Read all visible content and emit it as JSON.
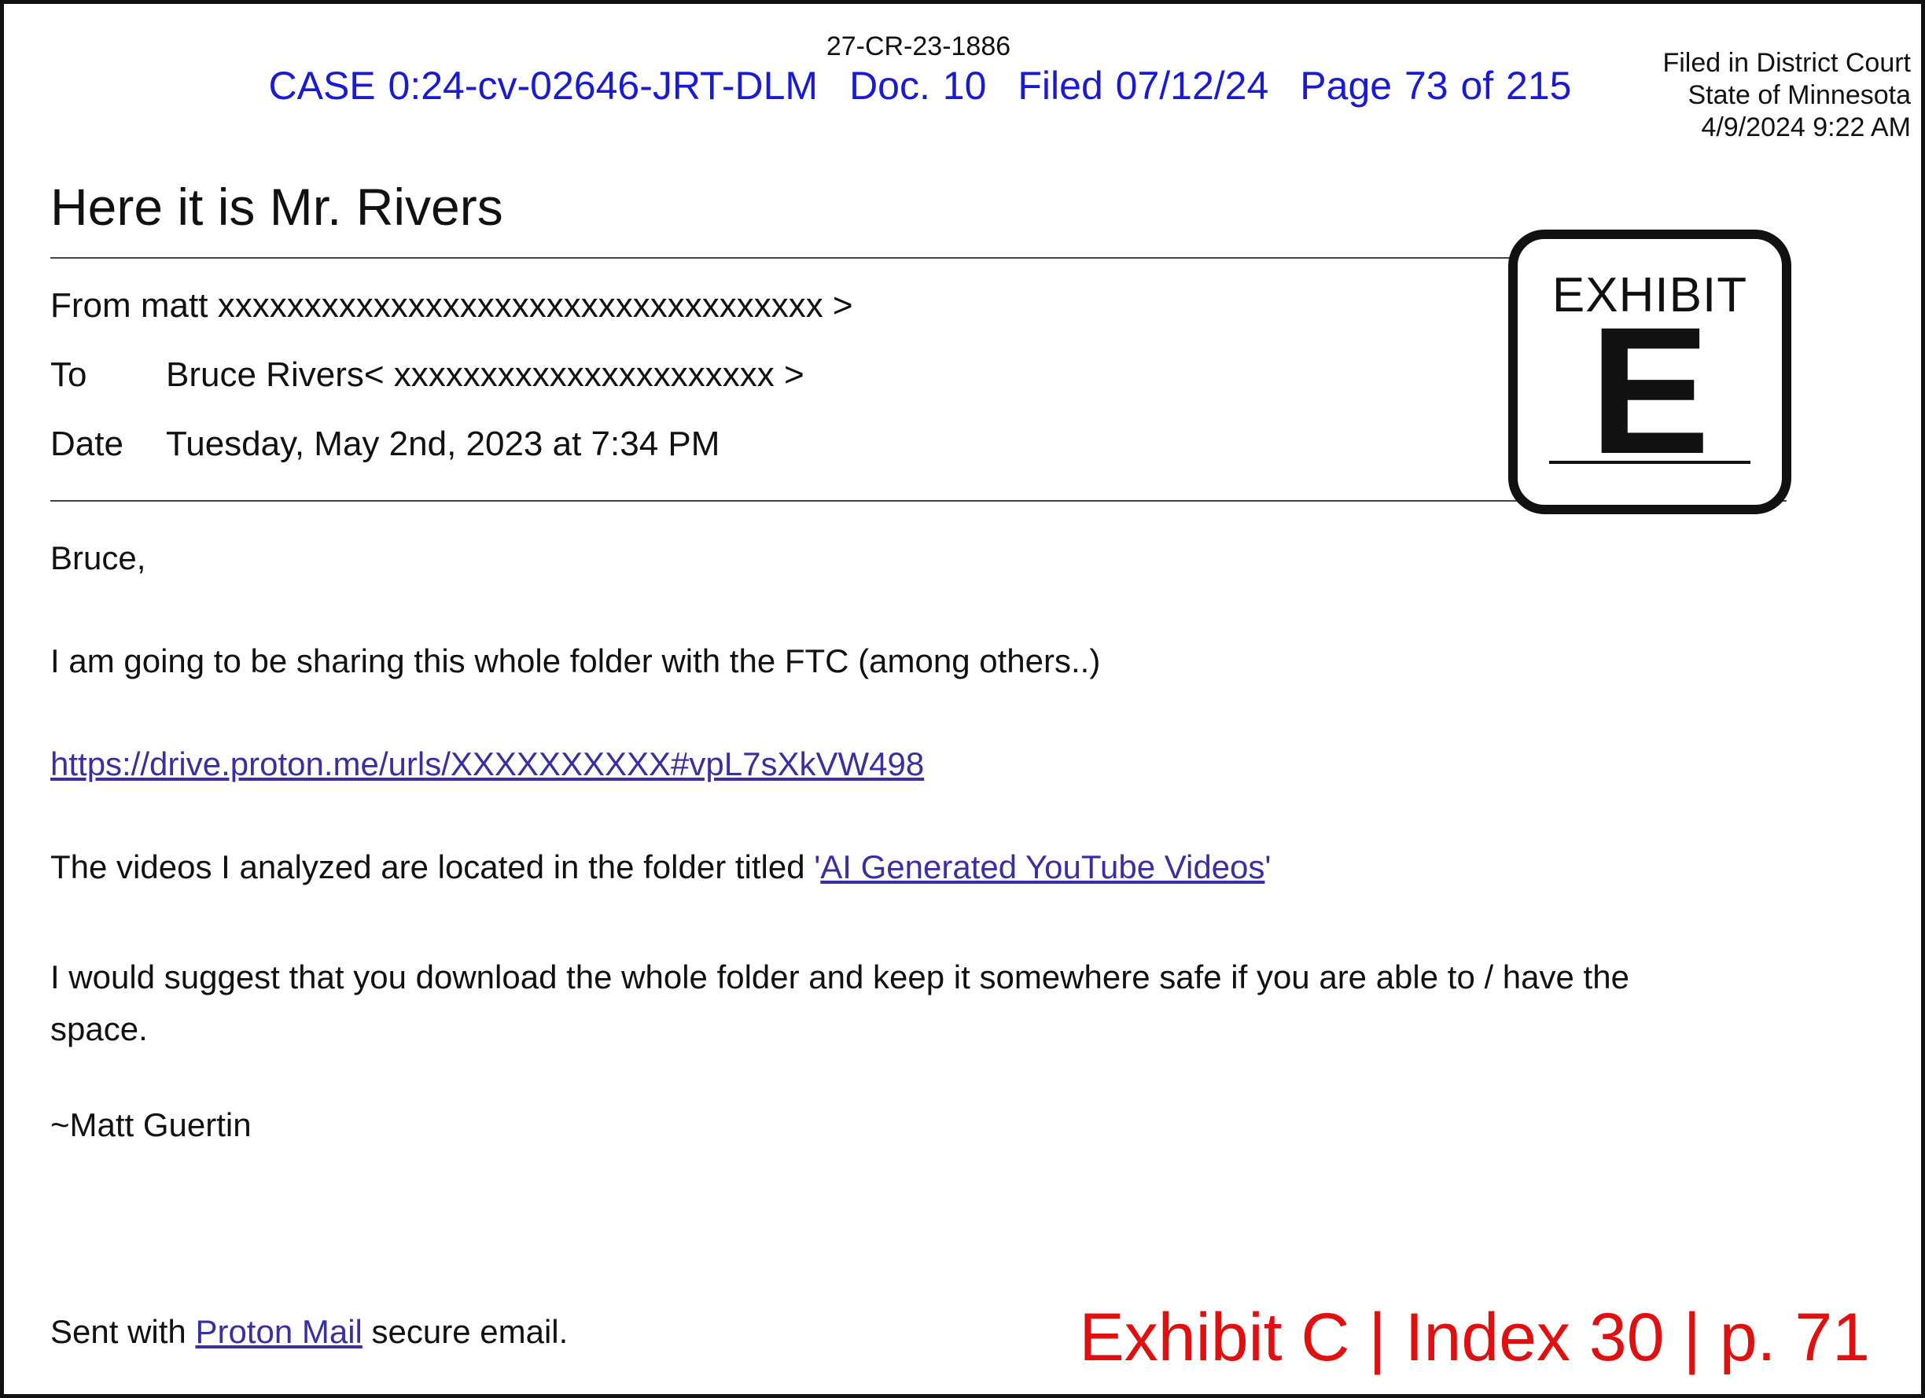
{
  "header": {
    "case_number": "27-CR-23-1886",
    "stamp": {
      "case": "CASE 0:24-cv-02646-JRT-DLM",
      "doc": "Doc. 10",
      "filed": "Filed 07/12/24",
      "page": "Page 73 of 215"
    },
    "filed_block": {
      "line1": "Filed in District Court",
      "line2": "State of Minnesota",
      "line3": "4/9/2024 9:22 AM"
    }
  },
  "email": {
    "subject": "Here it is Mr. Rivers",
    "from_label": "From",
    "from_value": "matt xxxxxxxxxxxxxxxxxxxxxxxxxxxxxxxxxxx >",
    "to_label": "To",
    "to_value": "Bruce Rivers< xxxxxxxxxxxxxxxxxxxxxx >",
    "date_label": "Date",
    "date_value": "Tuesday, May 2nd, 2023 at 7:34 PM",
    "greeting": "Bruce,",
    "paragraph1": "I am going to be sharing this whole folder with the FTC (among others..)",
    "link_url": "https://drive.proton.me/urls/XXXXXXXXXX#vpL7sXkVW498",
    "paragraph2_prefix": "The videos I analyzed are located in the folder titled ",
    "quote_open": "'",
    "folder_link": "AI Generated YouTube Videos",
    "quote_close": "'",
    "paragraph3": "I would suggest that you download the whole folder and keep it somewhere safe if you are able to / have the space.",
    "signature": "~Matt Guertin",
    "sent_with_prefix": "Sent with ",
    "sent_with_link": "Proton Mail",
    "sent_with_suffix": " secure email."
  },
  "exhibit_stamp": {
    "word": "EXHIBIT",
    "letter": "E"
  },
  "footer": {
    "exhibit_index": "Exhibit C | Index 30 | p. 71"
  },
  "colors": {
    "stamp_blue": "#1a1ad4",
    "link_purple": "#3a2fa0",
    "footer_red": "#e01010"
  }
}
